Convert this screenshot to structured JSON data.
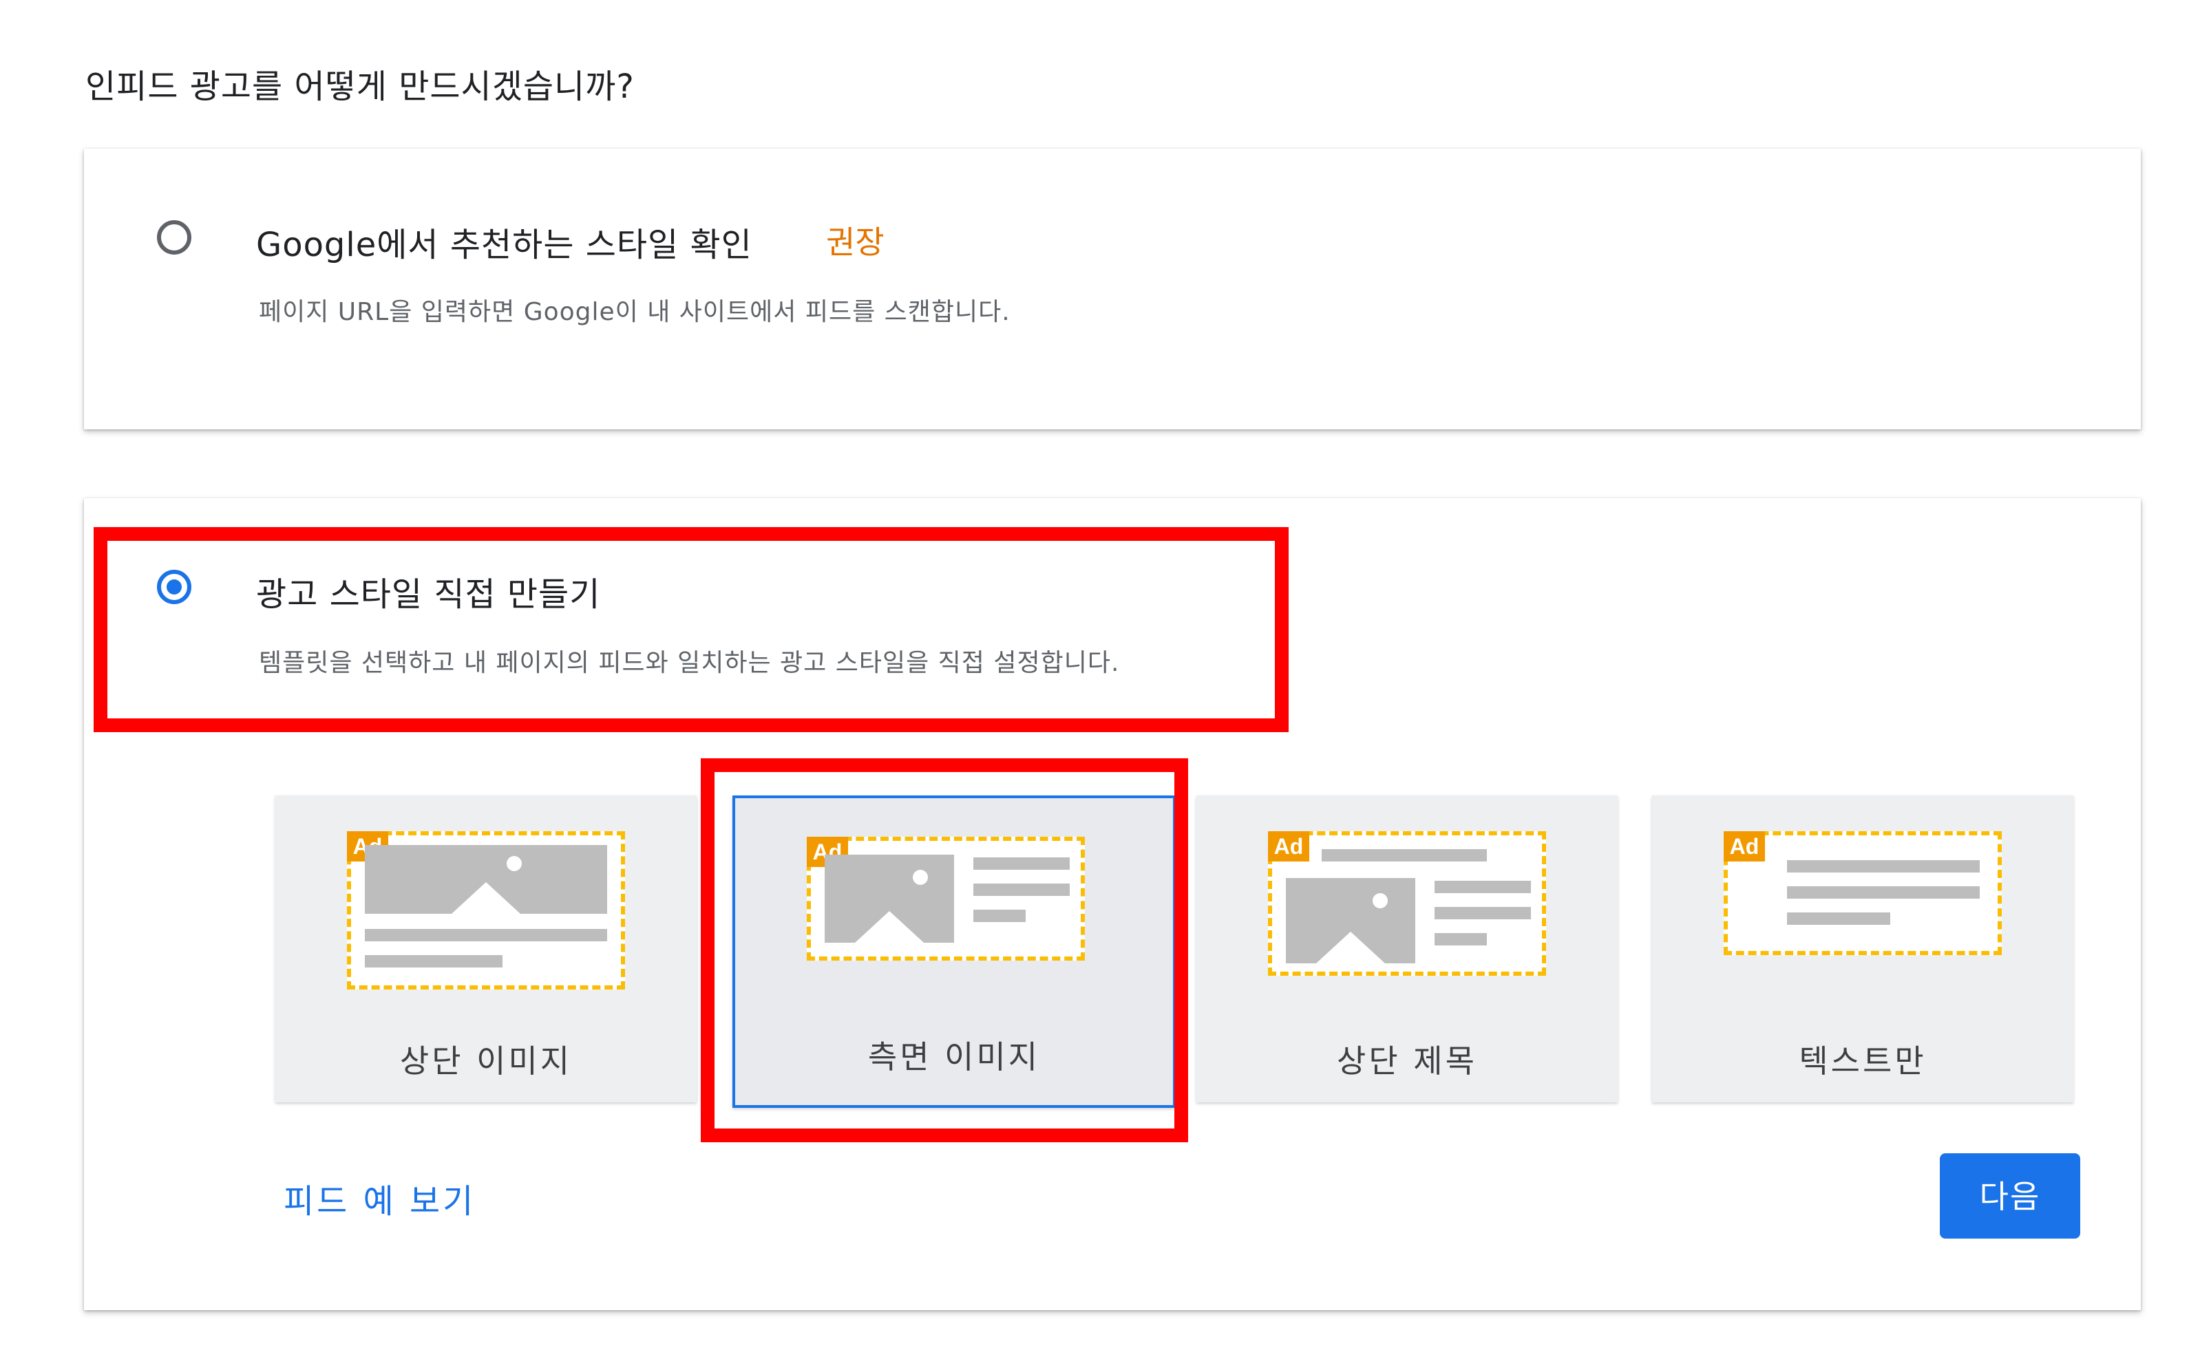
{
  "question": "인피드 광고를 어떻게 만드시겠습니까?",
  "options": [
    {
      "title": "Google에서 추천하는 스타일 확인",
      "badge": "권장",
      "description": "페이지 URL을 입력하면 Google이 내 사이트에서 피드를 스캔합니다.",
      "selected": false
    },
    {
      "title": "광고 스타일 직접 만들기",
      "description": "템플릿을 선택하고 내 페이지의 피드와 일치하는 광고 스타일을 직접 설정합니다.",
      "selected": true
    }
  ],
  "templates": [
    {
      "label": "상단 이미지",
      "icon": "top-image-layout-icon",
      "selected": false
    },
    {
      "label": "측면 이미지",
      "icon": "side-image-layout-icon",
      "selected": true
    },
    {
      "label": "상단 제목",
      "icon": "top-title-layout-icon",
      "selected": false
    },
    {
      "label": "텍스트만",
      "icon": "text-only-layout-icon",
      "selected": false
    }
  ],
  "ad_badge": "Ad",
  "preview_link": "피드 예 보기",
  "next_button": "다음",
  "colors": {
    "primary": "#1a73e8",
    "recommended": "#e37400",
    "highlight": "#ff0000",
    "ad_badge": "#f29900",
    "dashed_border": "#fbbc04"
  }
}
